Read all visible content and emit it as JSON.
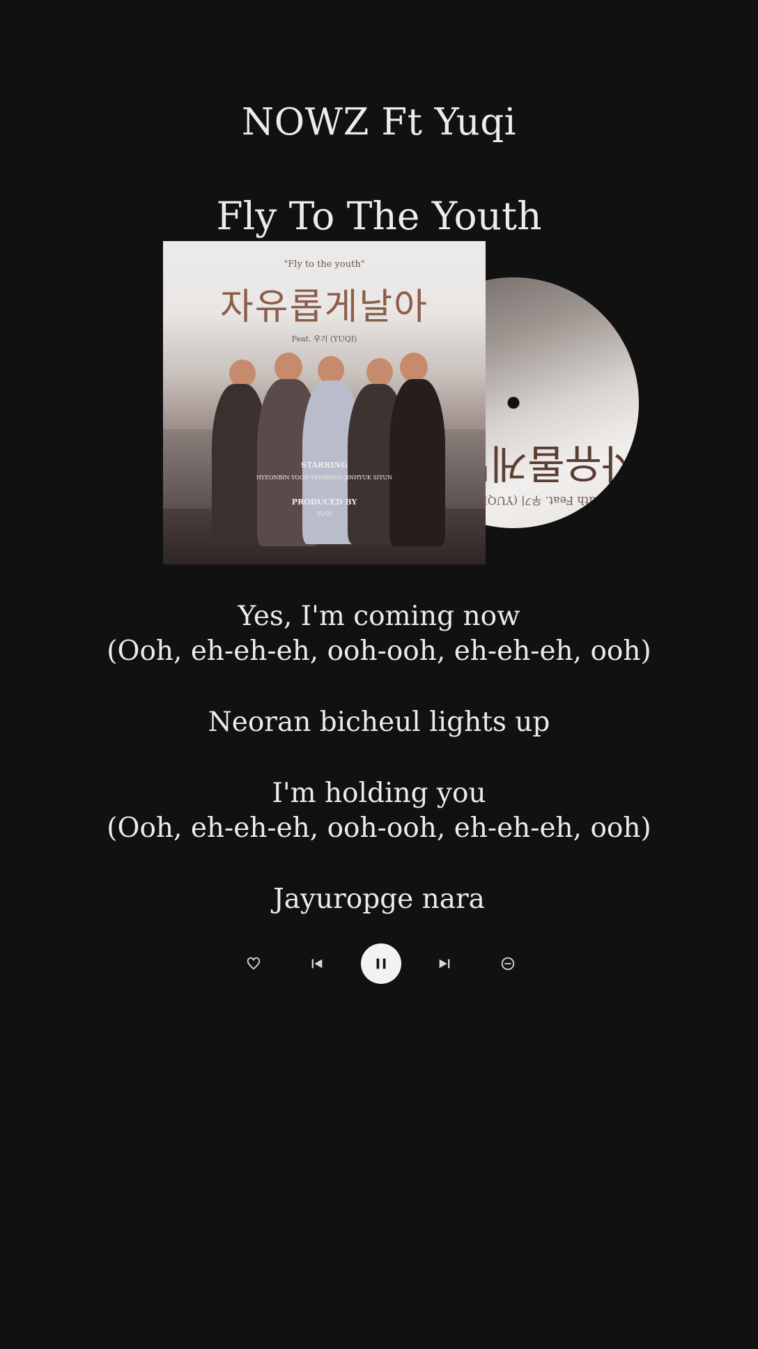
{
  "header": {
    "artist": "NOWZ Ft Yuqi",
    "song_title": "Fly To The Youth"
  },
  "artwork": {
    "cover_small_title": "\"Fly to the youth\"",
    "cover_big_title": "자유롭게날아",
    "cover_feat": "Feat. 우기 (YUQI)",
    "cover_starring_label": "STARRING",
    "cover_members": "HYEONBIN   YOON   YEONWOO   JINHYUK   SIYUN",
    "cover_produced_label": "PRODUCED BY",
    "cover_producer": "YUQI",
    "disc_title": "자유롭게날아",
    "disc_sub": "Fly to the youth   Feat. 우기 (YUQI)"
  },
  "lyrics": [
    "Yes, I'm coming now",
    "(Ooh, eh-eh-eh, ooh-ooh, eh-eh-eh, ooh)",
    "Neoran bicheul lights up",
    "I'm holding you",
    "(Ooh, eh-eh-eh, ooh-ooh, eh-eh-eh, ooh)",
    "Jayuropge nara"
  ],
  "controls": {
    "like_icon": "heart-icon",
    "previous_icon": "skip-previous-icon",
    "play_pause_icon": "pause-icon",
    "next_icon": "skip-next-icon",
    "remove_icon": "minus-circle-icon"
  },
  "colors": {
    "background": "#111111",
    "text": "#efece8",
    "play_button": "#f2f2f2"
  }
}
